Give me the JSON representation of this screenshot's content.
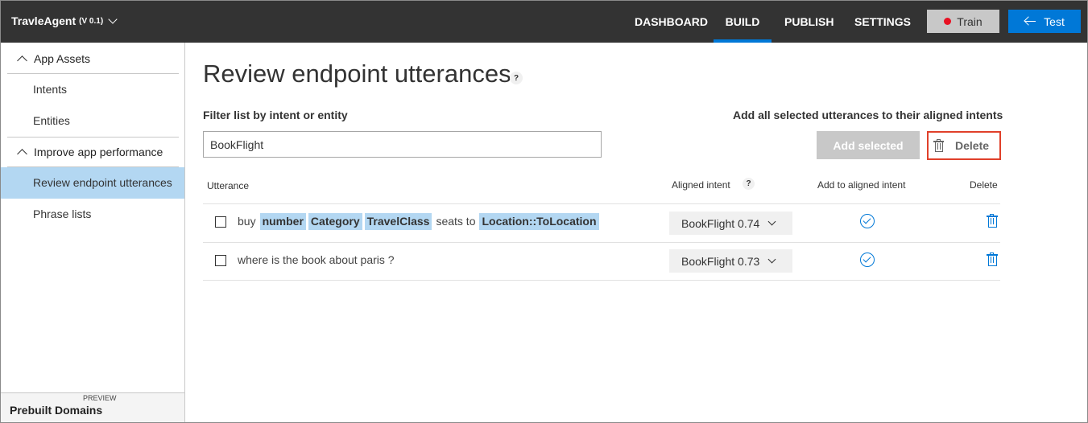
{
  "header": {
    "app_name": "TravleAgent",
    "version": "(V 0.1)",
    "nav": [
      {
        "label": "DASHBOARD",
        "active": false
      },
      {
        "label": "BUILD",
        "active": true
      },
      {
        "label": "PUBLISH",
        "active": false
      },
      {
        "label": "SETTINGS",
        "active": false
      }
    ],
    "train_label": "Train",
    "test_label": "Test",
    "train_status_color": "#e81123",
    "accent_color": "#0078d7"
  },
  "sidebar": {
    "sections": [
      {
        "title": "App Assets",
        "items": [
          "Intents",
          "Entities"
        ]
      },
      {
        "title": "Improve app performance",
        "items": [
          "Review endpoint utterances",
          "Phrase lists"
        ]
      }
    ],
    "active_item": "Review endpoint utterances",
    "prebuilt_badge": "PREVIEW",
    "prebuilt_label": "Prebuilt Domains"
  },
  "main": {
    "title": "Review endpoint utterances",
    "help": "?",
    "filter_label": "Filter list by intent or entity",
    "filter_value": "BookFlight",
    "add_all_label": "Add all selected utterances to their aligned intents",
    "add_selected_label": "Add selected",
    "delete_label": "Delete",
    "columns": {
      "utterance": "Utterance",
      "aligned_intent": "Aligned intent",
      "add_to_aligned": "Add to aligned intent",
      "delete": "Delete"
    },
    "rows": [
      {
        "tokens": [
          {
            "text": "buy",
            "entity": false
          },
          {
            "text": "number",
            "entity": true
          },
          {
            "text": "Category",
            "entity": true
          },
          {
            "text": "TravelClass",
            "entity": true
          },
          {
            "text": "seats to",
            "entity": false
          },
          {
            "text": "Location::ToLocation",
            "entity": true
          }
        ],
        "intent": "BookFlight 0.74",
        "checked": false
      },
      {
        "tokens": [
          {
            "text": "where is the book about paris ?",
            "entity": false
          }
        ],
        "intent": "BookFlight 0.73",
        "checked": false
      }
    ]
  }
}
